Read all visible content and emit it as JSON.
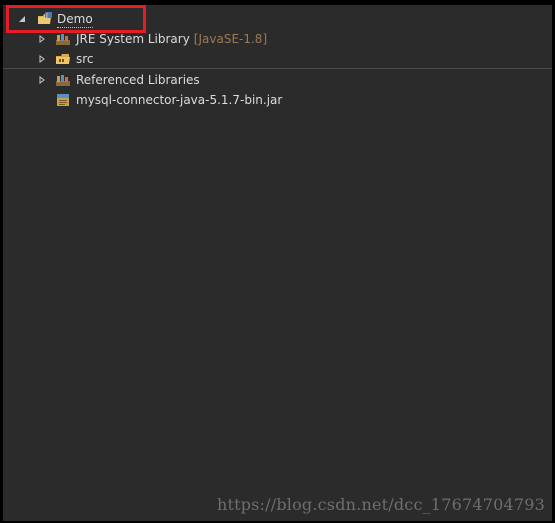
{
  "tree": {
    "project": {
      "label": "Demo",
      "icon": "java-project-icon",
      "expanded": true
    },
    "items": [
      {
        "label": "JRE System Library",
        "suffix": "[JavaSE-1.8]",
        "icon": "library-icon",
        "expandable": true
      },
      {
        "label": "src",
        "icon": "source-folder-icon",
        "expandable": true
      },
      {
        "label": "Referenced Libraries",
        "icon": "library-icon",
        "expandable": true
      },
      {
        "label": "mysql-connector-java-5.1.7-bin.jar",
        "icon": "jar-icon",
        "expandable": false
      }
    ]
  },
  "colors": {
    "background": "#2b2b2b",
    "text": "#dcdcdc",
    "suffix": "#9d7a52",
    "highlight": "#e81c24"
  },
  "watermark": "https://blog.csdn.net/dcc_17674704793"
}
